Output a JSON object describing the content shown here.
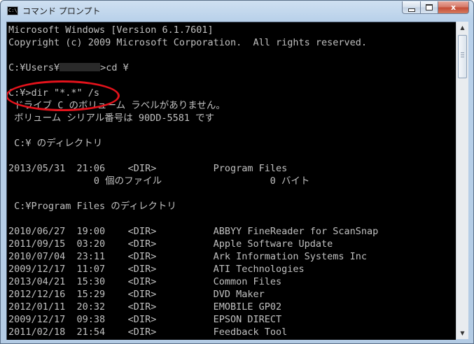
{
  "window": {
    "title": "コマンド プロンプト",
    "icon_text": "C:\\",
    "close_label": "x"
  },
  "colors": {
    "console_bg": "#000000",
    "console_fg": "#c0c0c0",
    "highlight": "#e3121b"
  },
  "console": {
    "lines": [
      "Microsoft Windows [Version 6.1.7601]",
      "Copyright (c) 2009 Microsoft Corporation.  All rights reserved.",
      "",
      "C:¥Users¥",
      "",
      "C:¥>dir \"*.*\" /s",
      " ドライブ C のボリューム ラベルがありません。",
      " ボリューム シリアル番号は 90DD-5581 です",
      "",
      " C:¥ のディレクトリ",
      "",
      "2013/05/31  21:06    <DIR>          Program Files",
      "               0 個のファイル                   0 バイト",
      "",
      " C:¥Program Files のディレクトリ",
      "",
      "2010/06/27  19:00    <DIR>          ABBYY FineReader for ScanSnap",
      "2011/09/15  03:20    <DIR>          Apple Software Update",
      "2010/07/04  23:11    <DIR>          Ark Information Systems Inc",
      "2009/12/17  11:07    <DIR>          ATI Technologies",
      "2013/04/21  15:30    <DIR>          Common Files",
      "2012/12/16  15:29    <DIR>          DVD Maker",
      "2012/01/11  20:32    <DIR>          EMOBILE GP02",
      "2009/12/17  09:38    <DIR>          EPSON DIRECT",
      "2011/02/18  21:54    <DIR>          Feedback Tool"
    ],
    "cd_suffix": ">cd ¥"
  },
  "scrollbar": {
    "up_icon": "arrow-up-icon",
    "down_icon": "arrow-down-icon"
  }
}
